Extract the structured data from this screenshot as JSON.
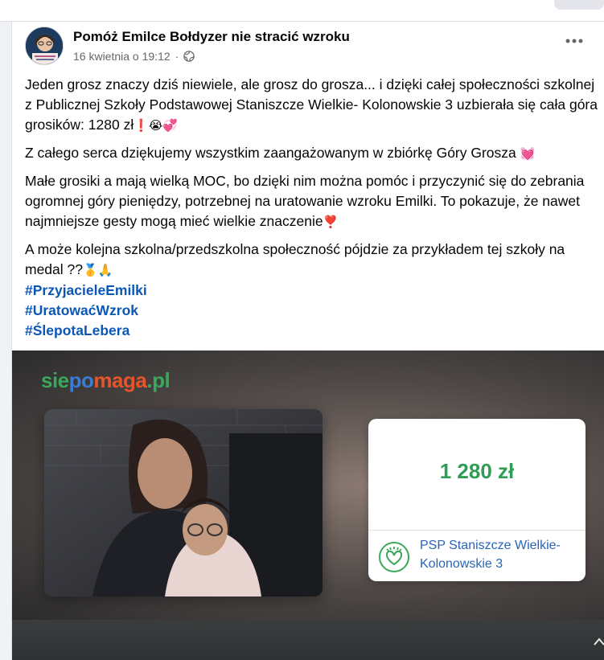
{
  "post": {
    "author": "Pomóż Emilce Bołdyzer nie stracić wzroku",
    "date": "16 kwietnia o 19:12",
    "separator": "·",
    "more_label": "•••",
    "paragraphs": [
      "Jeden grosz znaczy dziś niewiele, ale grosz do grosza... i dzięki całej społeczności szkolnej z Publicznej Szkoły Podstawowej Staniszcze Wielkie- Kolonowskie 3 uzbierała się cała góra grosików: 1280 zł",
      "Z całego serca dziękujemy wszystkim zaangażowanym w zbiórkę Góry Grosza",
      "Małe grosiki a mają wielką MOC, bo dzięki nim można pomóc i przyczynić się do zebrania ogromnej góry pieniędzy, potrzebnej na uratowanie wzroku Emilki. To pokazuje, że nawet najmniejsze gesty mogą mieć wielkie znaczenie",
      "A może kolejna szkolna/przedszkolna społeczność pójdzie za przykładem tej szkoły na medal ??"
    ],
    "emoji": {
      "p1": "❗😭💞",
      "p2": "💓",
      "p3": "❣️",
      "p4": "🥇🙏"
    },
    "hashtags": [
      "#PrzyjacieleEmilki",
      "#UratowaćWzrok",
      "#ŚlepotaLebera"
    ]
  },
  "media": {
    "logo_parts": [
      "sie",
      "po",
      "maga",
      ".pl"
    ],
    "amount": "1 280 zł",
    "beneficiary": "PSP Staniszcze Wielkie-Kolonowskie 3"
  },
  "icons": {
    "globe": "globe-icon",
    "more": "more-options-icon",
    "chevron": "chevron-up-icon"
  },
  "colors": {
    "link": "#0a57b8",
    "amount": "#2f9e55",
    "beneficiary": "#2a64b5"
  }
}
